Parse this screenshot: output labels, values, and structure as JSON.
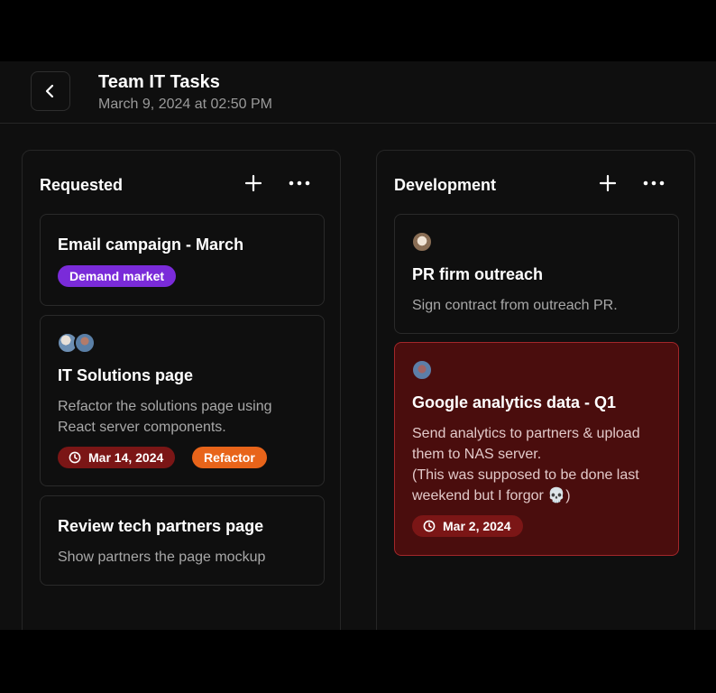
{
  "header": {
    "title": "Team IT Tasks",
    "subtitle": "March 9, 2024 at 02:50 PM"
  },
  "columns": [
    {
      "title": "Requested",
      "cards": [
        {
          "title": "Email campaign - March",
          "tags": [
            {
              "label": "Demand market",
              "color": "#7a2bd9"
            }
          ]
        },
        {
          "title": "IT Solutions page",
          "description_lines": [
            "Refactor the solutions page using",
            "React server components."
          ],
          "date": "Mar 14, 2024",
          "tags": [
            {
              "label": "Refactor",
              "color": "#e8641a"
            }
          ],
          "assignees": 2
        },
        {
          "title": "Review tech partners page",
          "description_lines": [
            "Show partners the page mockup"
          ]
        }
      ]
    },
    {
      "title": "Development",
      "cards": [
        {
          "title": "PR firm outreach",
          "description_lines": [
            "Sign contract from outreach PR."
          ],
          "assignees": 1
        },
        {
          "title": "Google analytics data - Q1",
          "description_lines": [
            "Send analytics to partners & upload",
            "them to NAS server.",
            "(This was supposed to be done last",
            "weekend but I forgor 💀)"
          ],
          "date": "Mar 2, 2024",
          "highlight": "overdue",
          "highlight_color": "#4a0d0d",
          "assignees": 1
        }
      ]
    }
  ],
  "colors": {
    "background": "#0f0f0f",
    "card_border": "#2a2a2a",
    "date_badge": "#7b1616",
    "overdue_border": "#a3272a"
  },
  "icons": {
    "back": "chevron-left-icon",
    "add": "plus-icon",
    "more": "more-horizontal-icon",
    "date": "clock-icon"
  }
}
